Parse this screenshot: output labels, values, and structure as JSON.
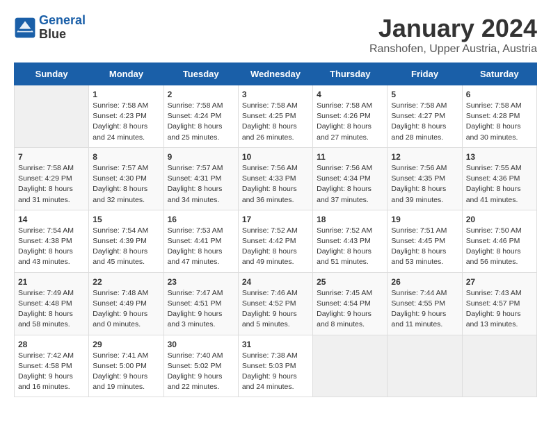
{
  "header": {
    "logo_line1": "General",
    "logo_line2": "Blue",
    "month_title": "January 2024",
    "location": "Ranshofen, Upper Austria, Austria"
  },
  "weekdays": [
    "Sunday",
    "Monday",
    "Tuesday",
    "Wednesday",
    "Thursday",
    "Friday",
    "Saturday"
  ],
  "weeks": [
    [
      {
        "day": "",
        "sunrise": "",
        "sunset": "",
        "daylight": ""
      },
      {
        "day": "1",
        "sunrise": "Sunrise: 7:58 AM",
        "sunset": "Sunset: 4:23 PM",
        "daylight": "Daylight: 8 hours and 24 minutes."
      },
      {
        "day": "2",
        "sunrise": "Sunrise: 7:58 AM",
        "sunset": "Sunset: 4:24 PM",
        "daylight": "Daylight: 8 hours and 25 minutes."
      },
      {
        "day": "3",
        "sunrise": "Sunrise: 7:58 AM",
        "sunset": "Sunset: 4:25 PM",
        "daylight": "Daylight: 8 hours and 26 minutes."
      },
      {
        "day": "4",
        "sunrise": "Sunrise: 7:58 AM",
        "sunset": "Sunset: 4:26 PM",
        "daylight": "Daylight: 8 hours and 27 minutes."
      },
      {
        "day": "5",
        "sunrise": "Sunrise: 7:58 AM",
        "sunset": "Sunset: 4:27 PM",
        "daylight": "Daylight: 8 hours and 28 minutes."
      },
      {
        "day": "6",
        "sunrise": "Sunrise: 7:58 AM",
        "sunset": "Sunset: 4:28 PM",
        "daylight": "Daylight: 8 hours and 30 minutes."
      }
    ],
    [
      {
        "day": "7",
        "sunrise": "Sunrise: 7:58 AM",
        "sunset": "Sunset: 4:29 PM",
        "daylight": "Daylight: 8 hours and 31 minutes."
      },
      {
        "day": "8",
        "sunrise": "Sunrise: 7:57 AM",
        "sunset": "Sunset: 4:30 PM",
        "daylight": "Daylight: 8 hours and 32 minutes."
      },
      {
        "day": "9",
        "sunrise": "Sunrise: 7:57 AM",
        "sunset": "Sunset: 4:31 PM",
        "daylight": "Daylight: 8 hours and 34 minutes."
      },
      {
        "day": "10",
        "sunrise": "Sunrise: 7:56 AM",
        "sunset": "Sunset: 4:33 PM",
        "daylight": "Daylight: 8 hours and 36 minutes."
      },
      {
        "day": "11",
        "sunrise": "Sunrise: 7:56 AM",
        "sunset": "Sunset: 4:34 PM",
        "daylight": "Daylight: 8 hours and 37 minutes."
      },
      {
        "day": "12",
        "sunrise": "Sunrise: 7:56 AM",
        "sunset": "Sunset: 4:35 PM",
        "daylight": "Daylight: 8 hours and 39 minutes."
      },
      {
        "day": "13",
        "sunrise": "Sunrise: 7:55 AM",
        "sunset": "Sunset: 4:36 PM",
        "daylight": "Daylight: 8 hours and 41 minutes."
      }
    ],
    [
      {
        "day": "14",
        "sunrise": "Sunrise: 7:54 AM",
        "sunset": "Sunset: 4:38 PM",
        "daylight": "Daylight: 8 hours and 43 minutes."
      },
      {
        "day": "15",
        "sunrise": "Sunrise: 7:54 AM",
        "sunset": "Sunset: 4:39 PM",
        "daylight": "Daylight: 8 hours and 45 minutes."
      },
      {
        "day": "16",
        "sunrise": "Sunrise: 7:53 AM",
        "sunset": "Sunset: 4:41 PM",
        "daylight": "Daylight: 8 hours and 47 minutes."
      },
      {
        "day": "17",
        "sunrise": "Sunrise: 7:52 AM",
        "sunset": "Sunset: 4:42 PM",
        "daylight": "Daylight: 8 hours and 49 minutes."
      },
      {
        "day": "18",
        "sunrise": "Sunrise: 7:52 AM",
        "sunset": "Sunset: 4:43 PM",
        "daylight": "Daylight: 8 hours and 51 minutes."
      },
      {
        "day": "19",
        "sunrise": "Sunrise: 7:51 AM",
        "sunset": "Sunset: 4:45 PM",
        "daylight": "Daylight: 8 hours and 53 minutes."
      },
      {
        "day": "20",
        "sunrise": "Sunrise: 7:50 AM",
        "sunset": "Sunset: 4:46 PM",
        "daylight": "Daylight: 8 hours and 56 minutes."
      }
    ],
    [
      {
        "day": "21",
        "sunrise": "Sunrise: 7:49 AM",
        "sunset": "Sunset: 4:48 PM",
        "daylight": "Daylight: 8 hours and 58 minutes."
      },
      {
        "day": "22",
        "sunrise": "Sunrise: 7:48 AM",
        "sunset": "Sunset: 4:49 PM",
        "daylight": "Daylight: 9 hours and 0 minutes."
      },
      {
        "day": "23",
        "sunrise": "Sunrise: 7:47 AM",
        "sunset": "Sunset: 4:51 PM",
        "daylight": "Daylight: 9 hours and 3 minutes."
      },
      {
        "day": "24",
        "sunrise": "Sunrise: 7:46 AM",
        "sunset": "Sunset: 4:52 PM",
        "daylight": "Daylight: 9 hours and 5 minutes."
      },
      {
        "day": "25",
        "sunrise": "Sunrise: 7:45 AM",
        "sunset": "Sunset: 4:54 PM",
        "daylight": "Daylight: 9 hours and 8 minutes."
      },
      {
        "day": "26",
        "sunrise": "Sunrise: 7:44 AM",
        "sunset": "Sunset: 4:55 PM",
        "daylight": "Daylight: 9 hours and 11 minutes."
      },
      {
        "day": "27",
        "sunrise": "Sunrise: 7:43 AM",
        "sunset": "Sunset: 4:57 PM",
        "daylight": "Daylight: 9 hours and 13 minutes."
      }
    ],
    [
      {
        "day": "28",
        "sunrise": "Sunrise: 7:42 AM",
        "sunset": "Sunset: 4:58 PM",
        "daylight": "Daylight: 9 hours and 16 minutes."
      },
      {
        "day": "29",
        "sunrise": "Sunrise: 7:41 AM",
        "sunset": "Sunset: 5:00 PM",
        "daylight": "Daylight: 9 hours and 19 minutes."
      },
      {
        "day": "30",
        "sunrise": "Sunrise: 7:40 AM",
        "sunset": "Sunset: 5:02 PM",
        "daylight": "Daylight: 9 hours and 22 minutes."
      },
      {
        "day": "31",
        "sunrise": "Sunrise: 7:38 AM",
        "sunset": "Sunset: 5:03 PM",
        "daylight": "Daylight: 9 hours and 24 minutes."
      },
      {
        "day": "",
        "sunrise": "",
        "sunset": "",
        "daylight": ""
      },
      {
        "day": "",
        "sunrise": "",
        "sunset": "",
        "daylight": ""
      },
      {
        "day": "",
        "sunrise": "",
        "sunset": "",
        "daylight": ""
      }
    ]
  ]
}
